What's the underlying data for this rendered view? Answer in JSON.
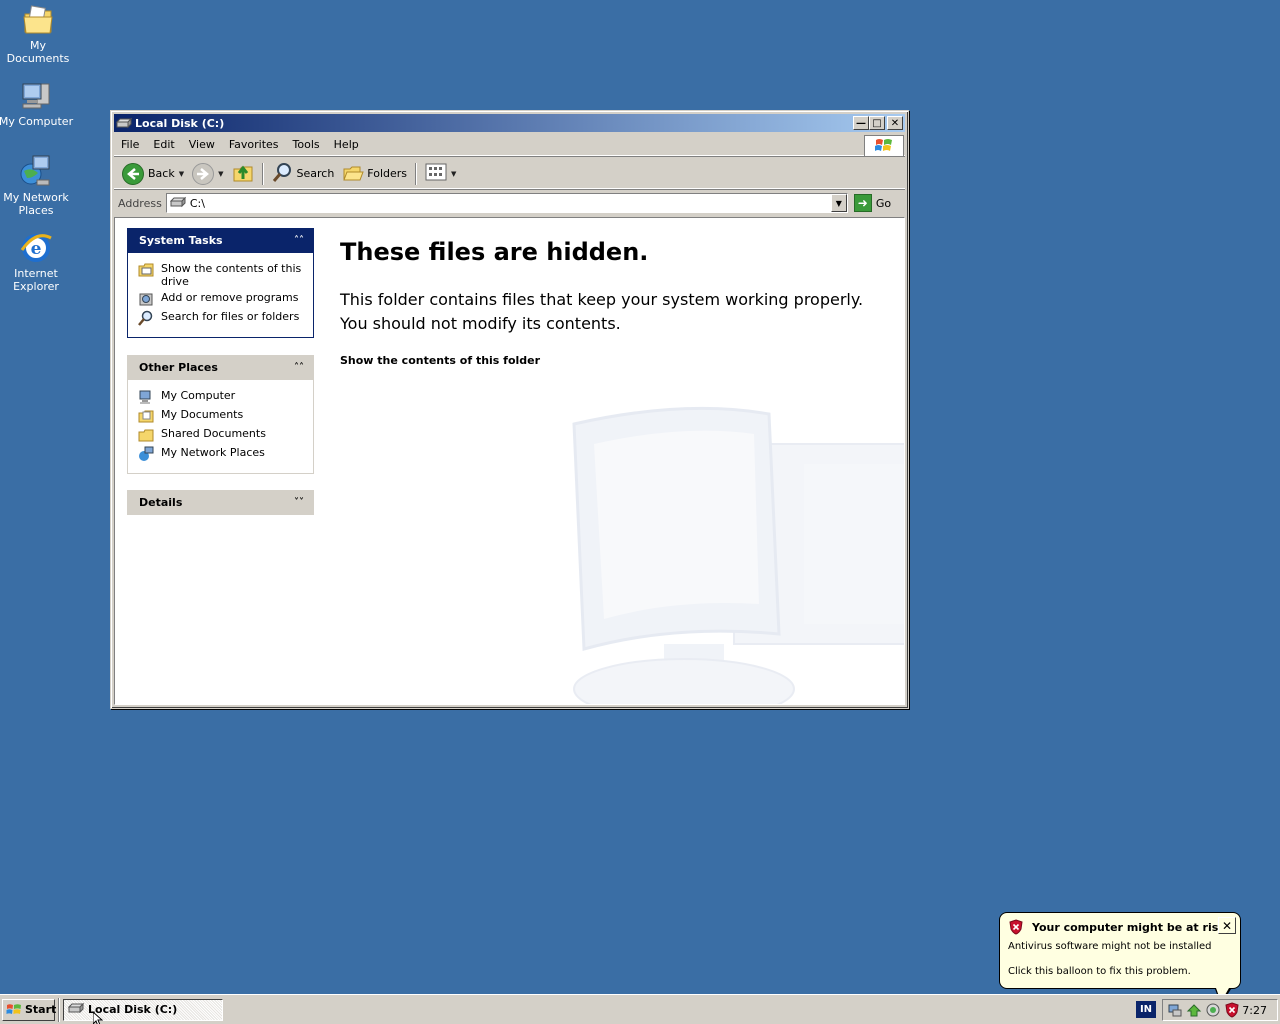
{
  "desktop": {
    "icons": [
      {
        "label": "My Documents"
      },
      {
        "label": "My Computer"
      },
      {
        "label": "My Network Places"
      },
      {
        "label": "Internet Explorer"
      }
    ]
  },
  "window": {
    "title": "Local Disk (C:)",
    "menu": [
      "File",
      "Edit",
      "View",
      "Favorites",
      "Tools",
      "Help"
    ],
    "toolbar": {
      "back": "Back",
      "search": "Search",
      "folders": "Folders"
    },
    "address": {
      "label": "Address",
      "value": "C:\\",
      "go": "Go"
    }
  },
  "taskpane": {
    "system_tasks": {
      "title": "System Tasks",
      "items": [
        "Show the contents of this drive",
        "Add or remove programs",
        "Search for files or folders"
      ]
    },
    "other_places": {
      "title": "Other Places",
      "items": [
        "My Computer",
        "My Documents",
        "Shared Documents",
        "My Network Places"
      ]
    },
    "details": {
      "title": "Details"
    }
  },
  "main": {
    "heading": "These files are hidden.",
    "body_line1": "This folder contains files that keep your system working properly.",
    "body_line2": "You should not modify its contents.",
    "link": "Show the contents of this folder"
  },
  "taskbar": {
    "start": "Start",
    "task": "Local Disk (C:)",
    "lang": "IN",
    "clock": "7:27"
  },
  "balloon": {
    "title": "Your computer might be at risk",
    "line1": "Antivirus software might not be installed",
    "line2": "Click this balloon to fix this problem."
  },
  "colors": {
    "desktop": "#3a6ea5",
    "titlebar": "#0a246a",
    "balloon": "#ffffe1"
  }
}
